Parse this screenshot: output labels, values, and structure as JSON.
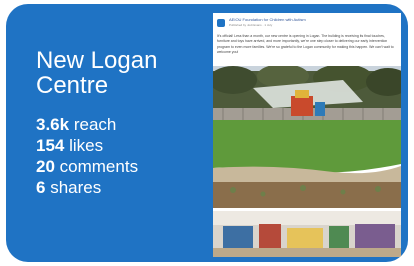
{
  "card": {
    "title_line1": "New Logan",
    "title_line2": "Centre",
    "stats": [
      {
        "value": "3.6k",
        "label": "reach"
      },
      {
        "value": "154",
        "label": "likes"
      },
      {
        "value": "20",
        "label": "comments"
      },
      {
        "value": "6",
        "label": "shares"
      }
    ]
  },
  "post": {
    "org_name": "AEIOU Foundation for Children with Autism",
    "meta": "Published by Jodi Evans · 1 July",
    "body": "It's official! Less than a month, our new centre is opening in Logan. The building is receiving its final touches, furniture and toys have arrived, and more importantly, we're one step closer to delivering our early intervention program to even more families. We're so grateful to the Logan community for making this happen. We can't wait to welcome you!",
    "colors": {
      "accent": "#1f73c4",
      "link": "#365899"
    }
  }
}
